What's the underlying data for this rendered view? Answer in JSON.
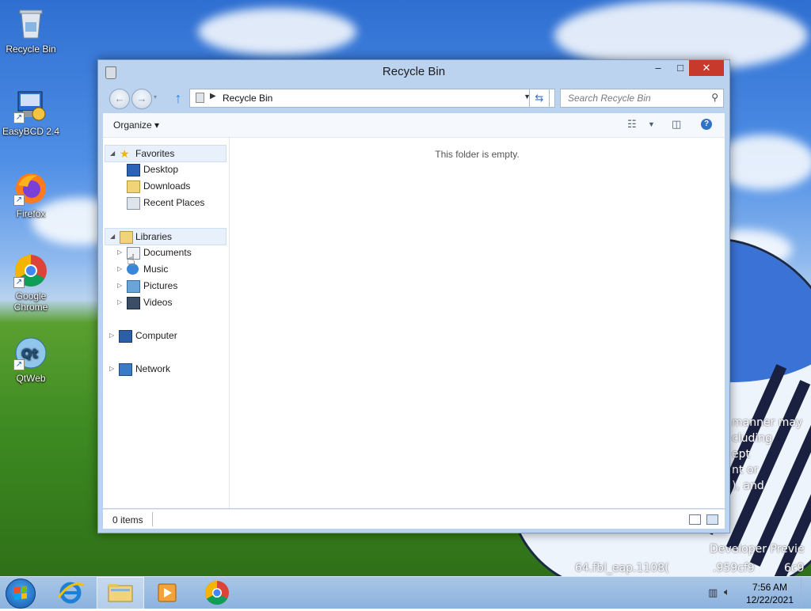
{
  "desktop": {
    "icons": [
      {
        "label": "Recycle Bin",
        "icon": "recycle-bin-icon"
      },
      {
        "label": "EasyBCD 2.4",
        "icon": "easybcd-icon"
      },
      {
        "label": "Firefox",
        "icon": "firefox-icon"
      },
      {
        "label": "Google Chrome",
        "icon": "chrome-icon"
      },
      {
        "label": "QtWeb",
        "icon": "qtweb-icon"
      }
    ],
    "watermark_lines": [
      "manner may",
      "cluding",
      "ept",
      "nt or",
      "), and",
      "Developer Previe",
      "64.fbl_eap.1108(",
      ".959cf9",
      "6c9"
    ]
  },
  "window": {
    "title": "Recycle Bin",
    "controls": {
      "minimize": "–",
      "maximize": "□",
      "close": "✕"
    },
    "nav": {
      "back": "←",
      "forward": "→",
      "up": "↑"
    },
    "address": {
      "path": "Recycle Bin"
    },
    "search": {
      "placeholder": "Search Recycle Bin"
    },
    "toolbar": {
      "organize_label": "Organize ▾"
    },
    "nav_pane": {
      "favorites": {
        "label": "Favorites",
        "items": [
          "Desktop",
          "Downloads",
          "Recent Places"
        ]
      },
      "libraries": {
        "label": "Libraries",
        "items": [
          "Documents",
          "Music",
          "Pictures",
          "Videos"
        ]
      },
      "computer": {
        "label": "Computer"
      },
      "network": {
        "label": "Network"
      }
    },
    "empty_message": "This folder is empty.",
    "status": {
      "items_count": "0 items"
    }
  },
  "taskbar": {
    "apps": [
      "internet-explorer",
      "file-explorer",
      "media-player",
      "google-chrome"
    ],
    "clock": {
      "time": "7:56 AM",
      "date": "12/22/2021"
    }
  },
  "colors": {
    "accent": "#2f73c9",
    "close": "#c7392b",
    "taskbar": "#9dbde3"
  }
}
